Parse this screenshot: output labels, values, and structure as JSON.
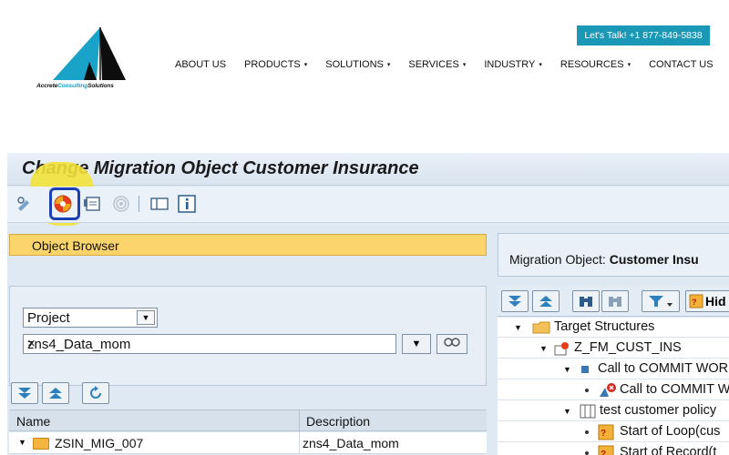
{
  "logo": {
    "text_part1": "Accrete",
    "text_part2": "Consulting",
    "text_part3": "Solutions"
  },
  "header": {
    "cta": "Let's Talk! +1 877-849-5838",
    "nav": [
      {
        "label": "ABOUT US",
        "dropdown": false
      },
      {
        "label": "PRODUCTS",
        "dropdown": true
      },
      {
        "label": "SOLUTIONS",
        "dropdown": true
      },
      {
        "label": "SERVICES",
        "dropdown": true
      },
      {
        "label": "INDUSTRY",
        "dropdown": true
      },
      {
        "label": "RESOURCES",
        "dropdown": true
      },
      {
        "label": "CONTACT US",
        "dropdown": false
      }
    ],
    "caret": "▾"
  },
  "sap": {
    "title": "Change Migration Object Customer Insurance",
    "object_browser": "Object Browser",
    "selector_value": "Project",
    "search_value": "zns4_Data_mom",
    "clear_glyph": "×",
    "grid": {
      "col_name": "Name",
      "col_description": "Description",
      "row": {
        "name": "ZSIN_MIG_007",
        "description": "zns4_Data_mom"
      }
    },
    "right": {
      "label": "Migration Object:",
      "value": "Customer Insu",
      "hide_label": "Hid",
      "tree": [
        {
          "label": "Target Structures",
          "level": 0,
          "icon": "folder"
        },
        {
          "label": "Z_FM_CUST_INS",
          "level": 1,
          "icon": "function-module"
        },
        {
          "label": "Call to COMMIT WOR",
          "level": 2,
          "icon": "node"
        },
        {
          "label": "Call to COMMIT W",
          "level": 3,
          "icon": "call"
        },
        {
          "label": "test customer policy",
          "level": 2,
          "icon": "table"
        },
        {
          "label": "Start of Loop(cus",
          "level": 3,
          "icon": "loop"
        },
        {
          "label": "Start of Record(t",
          "level": 3,
          "icon": "loop"
        }
      ]
    }
  },
  "colors": {
    "cta": "#1b98b5",
    "highlight": "#f3e23a",
    "object_bar": "#fbd56c",
    "selection": "#1c3fb5"
  }
}
